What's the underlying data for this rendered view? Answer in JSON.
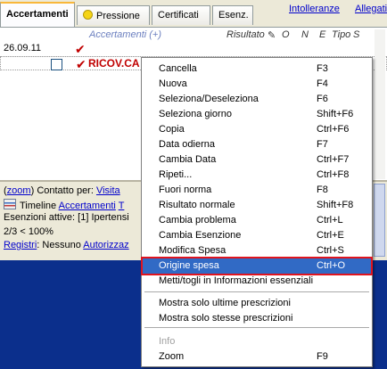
{
  "tabs": [
    {
      "label": "Accertamenti",
      "active": true
    },
    {
      "label": "Pressione",
      "active": false
    },
    {
      "label": "Certificati",
      "active": false
    },
    {
      "label": "Esenz.",
      "active": false
    }
  ],
  "top_links": [
    "Intolleranze",
    "Allegati"
  ],
  "grid": {
    "header_link": "Accertamenti (+)",
    "header_cols": [
      "Risultato",
      "O",
      "N",
      "E",
      "Tipo",
      "S"
    ],
    "row1_date": "26.09.11",
    "row2_text": "RICOV.CA"
  },
  "bottom": {
    "zoom_link": "zoom",
    "contact_label": "Contatto per:",
    "contact_link": "Visita",
    "timeline_label": "Timeline",
    "timeline_link": "Accertamenti",
    "timeline_link2": "T",
    "exemptions": "Esenzioni attive: [1] Ipertensi",
    "ratio": "2/3 < 100%",
    "registri_link": "Registri",
    "registri_text": ": Nessuno",
    "autorizz_link": "Autorizzaz"
  },
  "menu": {
    "items": [
      {
        "label": "Cancella",
        "shortcut": "F3"
      },
      {
        "label": "Nuova",
        "shortcut": "F4"
      },
      {
        "label": "Seleziona/Deseleziona",
        "shortcut": "F6"
      },
      {
        "label": "Seleziona giorno",
        "shortcut": "Shift+F6"
      },
      {
        "label": "Copia",
        "shortcut": "Ctrl+F6"
      },
      {
        "label": "Data odierna",
        "shortcut": "F7"
      },
      {
        "label": "Cambia Data",
        "shortcut": "Ctrl+F7"
      },
      {
        "label": "Ripeti...",
        "shortcut": "Ctrl+F8"
      },
      {
        "label": "Fuori norma",
        "shortcut": "F8"
      },
      {
        "label": "Risultato normale",
        "shortcut": "Shift+F8"
      },
      {
        "label": "Cambia problema",
        "shortcut": "Ctrl+L"
      },
      {
        "label": "Cambia Esenzione",
        "shortcut": "Ctrl+E"
      },
      {
        "label": "Modifica Spesa",
        "shortcut": "Ctrl+S"
      },
      {
        "label": "Origine spesa",
        "shortcut": "Ctrl+O"
      },
      {
        "label": "Metti/togli in Informazioni essenziali",
        "shortcut": ""
      },
      {
        "label": "Mostra solo ultime prescrizioni",
        "shortcut": ""
      },
      {
        "label": "Mostra solo stesse prescrizioni",
        "shortcut": ""
      },
      {
        "label": "Info",
        "shortcut": ""
      },
      {
        "label": "Zoom",
        "shortcut": "F9"
      }
    ]
  },
  "colors": {
    "menu_highlight": "#316ac5",
    "highlight_outline": "#e0141e",
    "check_red": "#c00000",
    "background_blue": "#0b2f8c"
  }
}
